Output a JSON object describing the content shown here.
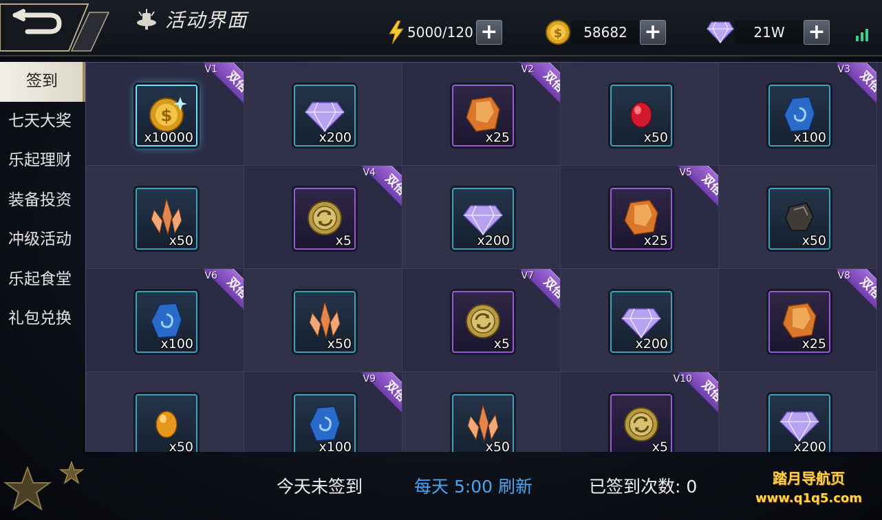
{
  "header": {
    "title": "活动界面",
    "energy": {
      "value": "5000/120",
      "icon": "lightning-icon"
    },
    "gold": {
      "value": "58682",
      "icon": "gold-coin-icon"
    },
    "gems": {
      "value": "21W",
      "icon": "diamond-icon"
    },
    "plus_label": "+"
  },
  "sidebar": {
    "items": [
      {
        "label": "签到",
        "active": true
      },
      {
        "label": "七天大奖"
      },
      {
        "label": "乐起理财"
      },
      {
        "label": "装备投资"
      },
      {
        "label": "冲级活动"
      },
      {
        "label": "乐起食堂"
      },
      {
        "label": "礼包兑换"
      }
    ]
  },
  "rewards": [
    {
      "icon": "gold-coin",
      "qty": "x10000",
      "vip": "V1",
      "double": "双倍",
      "frame": "blue",
      "selected": true
    },
    {
      "icon": "diamond",
      "qty": "x200",
      "frame": "blue"
    },
    {
      "icon": "amber-ore",
      "qty": "x25",
      "vip": "V2",
      "double": "双倍",
      "frame": "purple"
    },
    {
      "icon": "red-gem",
      "qty": "x50",
      "frame": "blue"
    },
    {
      "icon": "blue-stone",
      "qty": "x100",
      "vip": "V3",
      "double": "双倍",
      "frame": "blue"
    },
    {
      "icon": "crystal-shard",
      "qty": "x50",
      "frame": "blue"
    },
    {
      "icon": "refresh-coin",
      "qty": "x5",
      "vip": "V4",
      "double": "双倍",
      "frame": "purple"
    },
    {
      "icon": "diamond",
      "qty": "x200",
      "frame": "blue"
    },
    {
      "icon": "amber-ore",
      "qty": "x25",
      "vip": "V5",
      "double": "双倍",
      "frame": "purple"
    },
    {
      "icon": "black-stone",
      "qty": "x50",
      "frame": "blue"
    },
    {
      "icon": "blue-stone",
      "qty": "x100",
      "vip": "V6",
      "double": "双倍",
      "frame": "blue"
    },
    {
      "icon": "crystal-shard",
      "qty": "x50",
      "frame": "blue"
    },
    {
      "icon": "refresh-coin",
      "qty": "x5",
      "vip": "V7",
      "double": "双倍",
      "frame": "purple"
    },
    {
      "icon": "diamond",
      "qty": "x200",
      "frame": "blue"
    },
    {
      "icon": "amber-ore",
      "qty": "x25",
      "vip": "V8",
      "double": "双倍",
      "frame": "purple"
    },
    {
      "icon": "orange-gem",
      "qty": "x50",
      "frame": "blue"
    },
    {
      "icon": "blue-stone",
      "qty": "x100",
      "vip": "V9",
      "double": "双倍",
      "frame": "blue"
    },
    {
      "icon": "crystal-shard",
      "qty": "x50",
      "frame": "blue"
    },
    {
      "icon": "refresh-coin",
      "qty": "x5",
      "vip": "V10",
      "double": "双倍",
      "frame": "purple"
    },
    {
      "icon": "diamond",
      "qty": "x200",
      "frame": "blue"
    }
  ],
  "footer": {
    "status": "今天未签到",
    "refresh": "每天  5:00  刷新",
    "count_label": "已签到次数:",
    "count_value": "0",
    "watermark_line1": "踏月导航页",
    "watermark_line2": "www.q1q5.com"
  },
  "colors": {
    "accent_blue": "#4aa6f0",
    "ribbon_purple": "#8a52c4",
    "panel_bg": "#2b2b45",
    "watermark": "#ffd34a"
  }
}
